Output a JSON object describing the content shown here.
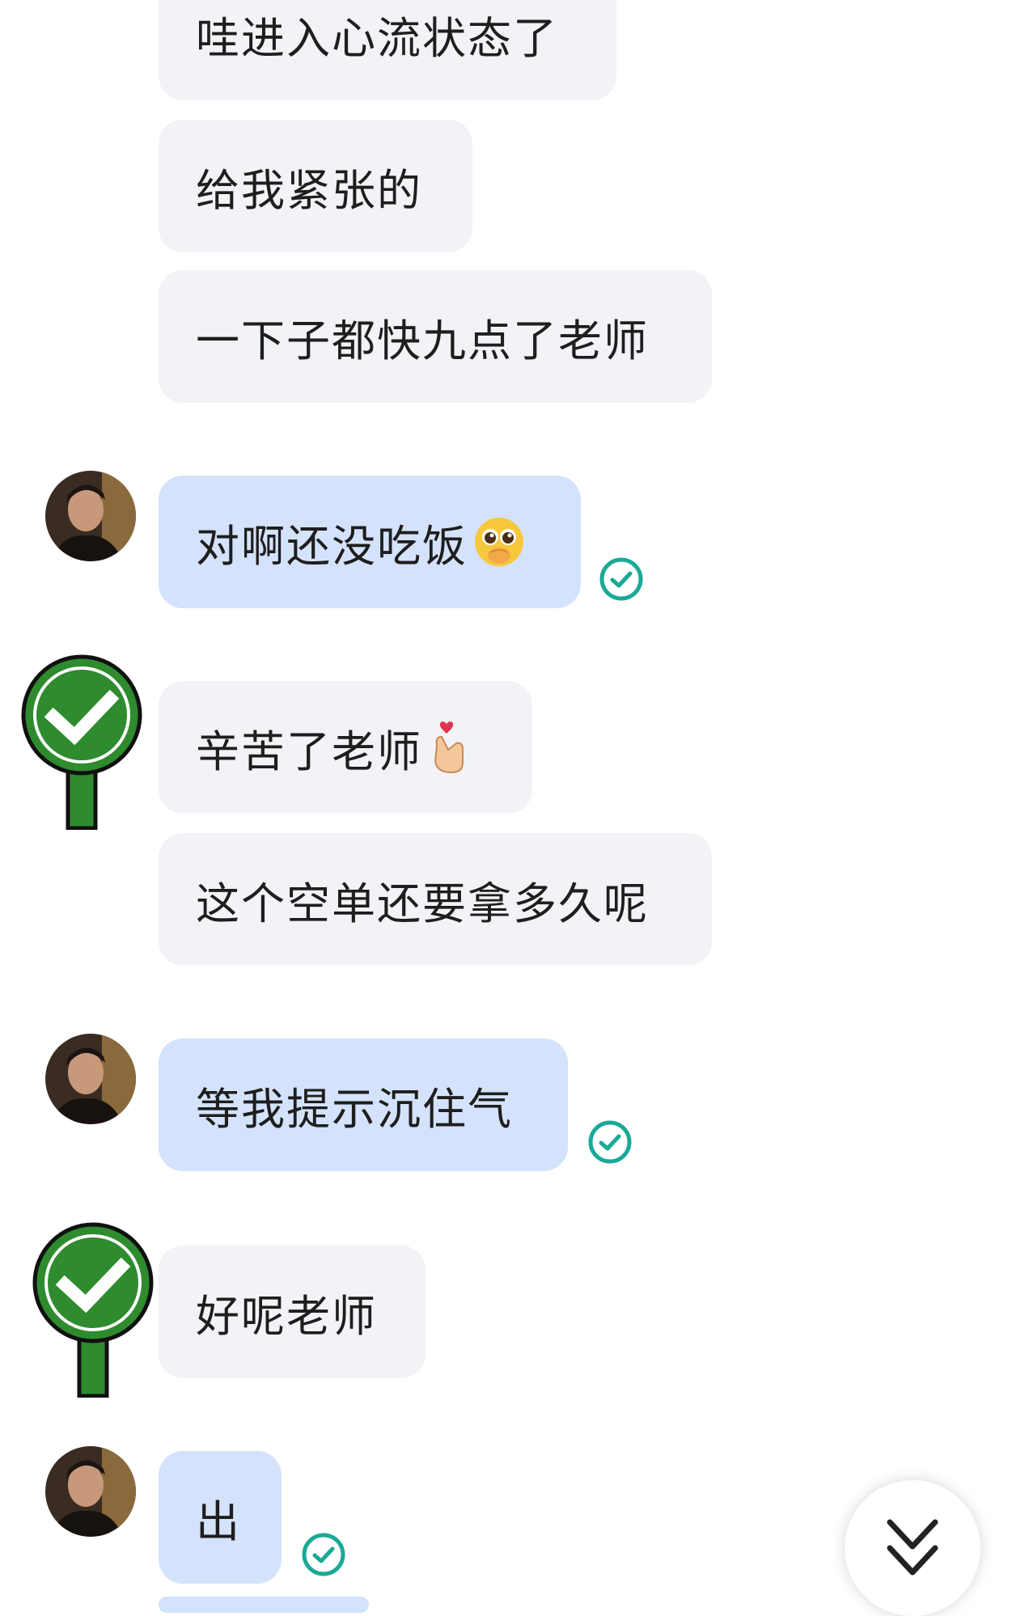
{
  "messages": [
    {
      "text": "哇进入心流状态了",
      "side": "other",
      "style": "grey"
    },
    {
      "text": "给我紧张的",
      "side": "other",
      "style": "grey"
    },
    {
      "text": "一下子都快九点了老师",
      "side": "other",
      "style": "grey"
    },
    {
      "text": "对啊还没吃饭",
      "side": "self",
      "style": "blue",
      "emoji": "pleading-face-emoji",
      "read": true
    },
    {
      "text": "辛苦了老师",
      "side": "other",
      "style": "grey",
      "emoji": "finger-heart-emoji"
    },
    {
      "text": "这个空单还要拿多久呢",
      "side": "other",
      "style": "grey"
    },
    {
      "text": "等我提示沉住气",
      "side": "self",
      "style": "blue",
      "read": true
    },
    {
      "text": "好呢老师",
      "side": "other",
      "style": "grey"
    },
    {
      "text": "出",
      "side": "self",
      "style": "blue",
      "read": true
    }
  ],
  "icons": {
    "read_receipt": "check-circle-icon",
    "other_avatar": "green-check-sign-icon",
    "scroll_button": "double-chevron-down-icon"
  },
  "colors": {
    "grey_bubble": "#f1f3f6",
    "blue_bubble": "#d4e3fb",
    "read_receipt": "#1aa996",
    "sign_green": "#2e8b2e"
  }
}
